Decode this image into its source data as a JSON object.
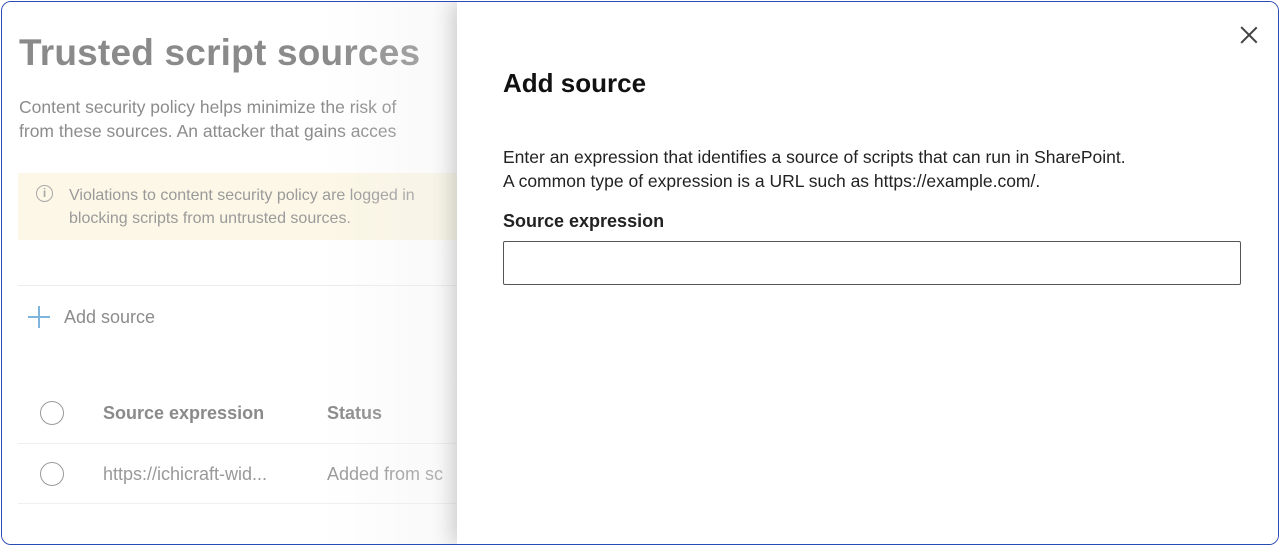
{
  "background": {
    "title": "Trusted script sources",
    "description": {
      "line1": "Content security policy helps minimize the risk of",
      "line2": "from these sources. An attacker that gains acces"
    },
    "notice": {
      "icon": "info-icon",
      "line1": "Violations to content security policy are logged in",
      "line2": "blocking scripts from untrusted sources."
    },
    "add_button_label": "Add source",
    "table": {
      "headers": [
        "Source expression",
        "Status"
      ],
      "rows": [
        {
          "source": "https://ichicraft-wid...",
          "status": "Added from sc"
        }
      ]
    }
  },
  "panel": {
    "title": "Add source",
    "description": {
      "line1": "Enter an expression that identifies a source of scripts that can run in SharePoint.",
      "line2": "A common type of expression is a URL such as https://example.com/."
    },
    "field_label": "Source expression",
    "field_value": "",
    "close_icon": "close-icon"
  },
  "colors": {
    "frame_border": "#2a4bb3",
    "notice_bg": "#fcf7e6",
    "accent_plus": "#7fb4dc"
  }
}
